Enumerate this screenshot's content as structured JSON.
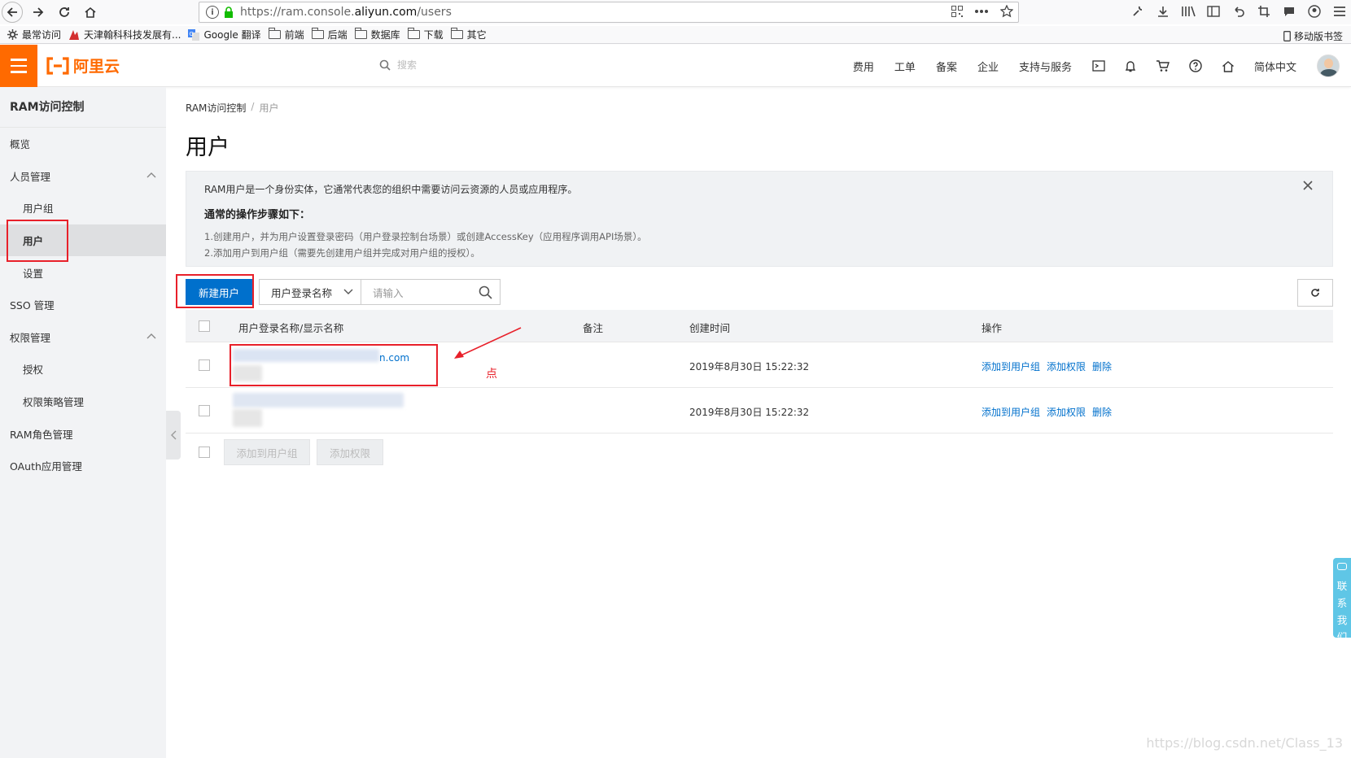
{
  "browser": {
    "url_prefix": "https://ram.console.",
    "url_domain": "aliyun.com",
    "url_suffix": "/users",
    "info_glyph": "i",
    "bookmarks": [
      {
        "label": "最常访问",
        "icon": "gear-icon"
      },
      {
        "label": "天津翰科科技发展有...",
        "icon": "site-favicon"
      },
      {
        "label": "Google 翻译",
        "icon": "translate-icon"
      },
      {
        "label": "前端",
        "icon": "folder-icon"
      },
      {
        "label": "后端",
        "icon": "folder-icon"
      },
      {
        "label": "数据库",
        "icon": "folder-icon"
      },
      {
        "label": "下载",
        "icon": "folder-icon"
      },
      {
        "label": "其它",
        "icon": "folder-icon"
      }
    ],
    "mobile_bookmarks": "移动版书签"
  },
  "topbar": {
    "logo": "阿里云",
    "search_placeholder": "搜索",
    "nav": [
      "费用",
      "工单",
      "备案",
      "企业",
      "支持与服务"
    ],
    "language": "简体中文"
  },
  "sidebar": {
    "title": "RAM访问控制",
    "items": [
      {
        "label": "概览",
        "level": 1
      },
      {
        "label": "人员管理",
        "level": 1,
        "expanded": true
      },
      {
        "label": "用户组",
        "level": 2
      },
      {
        "label": "用户",
        "level": 2,
        "active": true
      },
      {
        "label": "设置",
        "level": 2
      },
      {
        "label": "SSO 管理",
        "level": 1
      },
      {
        "label": "权限管理",
        "level": 1,
        "expanded": true
      },
      {
        "label": "授权",
        "level": 2
      },
      {
        "label": "权限策略管理",
        "level": 2
      },
      {
        "label": "RAM角色管理",
        "level": 1
      },
      {
        "label": "OAuth应用管理",
        "level": 1
      }
    ]
  },
  "main": {
    "breadcrumb": [
      "RAM访问控制",
      "用户"
    ],
    "breadcrumb_sep": "/",
    "title": "用户",
    "notice": {
      "line1": "RAM用户是一个身份实体，它通常代表您的组织中需要访问云资源的人员或应用程序。",
      "line2": "通常的操作步骤如下：",
      "line3": "1.创建用户，并为用户设置登录密码（用户登录控制台场景）或创建AccessKey（应用程序调用API场景）。",
      "line4": "2.添加用户到用户组（需要先创建用户组并完成对用户组的授权）。"
    },
    "create_button": "新建用户",
    "filter_field": "用户登录名称",
    "filter_placeholder": "请输入",
    "table": {
      "headers": {
        "name": "用户登录名称/显示名称",
        "note": "备注",
        "created": "创建时间",
        "ops": "操作"
      },
      "rows": [
        {
          "name_visible": "n.com",
          "created": "2019年8月30日 15:22:32",
          "ops": [
            "添加到用户组",
            "添加权限",
            "删除"
          ]
        },
        {
          "name_visible": "",
          "created": "2019年8月30日 15:22:32",
          "ops": [
            "添加到用户组",
            "添加权限",
            "删除"
          ]
        }
      ]
    },
    "batch_buttons": [
      "添加到用户组",
      "添加权限"
    ],
    "annotation": "点"
  },
  "contact": [
    "联",
    "系",
    "我",
    "们"
  ],
  "watermark": "https://blog.csdn.net/Class_13",
  "colors": {
    "brand": "#ff6a00",
    "primary": "#0070cc",
    "annotation": "#e8202a",
    "contact": "#5fc6e6"
  }
}
